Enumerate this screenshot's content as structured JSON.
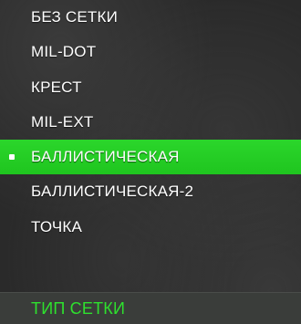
{
  "menu": {
    "items": [
      {
        "label": "БЕЗ СЕТКИ"
      },
      {
        "label": "MIL-DOT"
      },
      {
        "label": "КРЕСТ"
      },
      {
        "label": "MIL-EXT"
      },
      {
        "label": "БАЛЛИСТИЧЕСКАЯ",
        "selected": true
      },
      {
        "label": "БАЛЛИСТИЧЕСКАЯ-2"
      },
      {
        "label": "ТОЧКА"
      }
    ],
    "selected_index": 4
  },
  "footer": {
    "title": "ТИП СЕТКИ"
  },
  "colors": {
    "accent": "#22cc22",
    "title_text": "#2ee02e",
    "item_text": "#ffffff",
    "footer_bg": "#3a3d3a"
  }
}
